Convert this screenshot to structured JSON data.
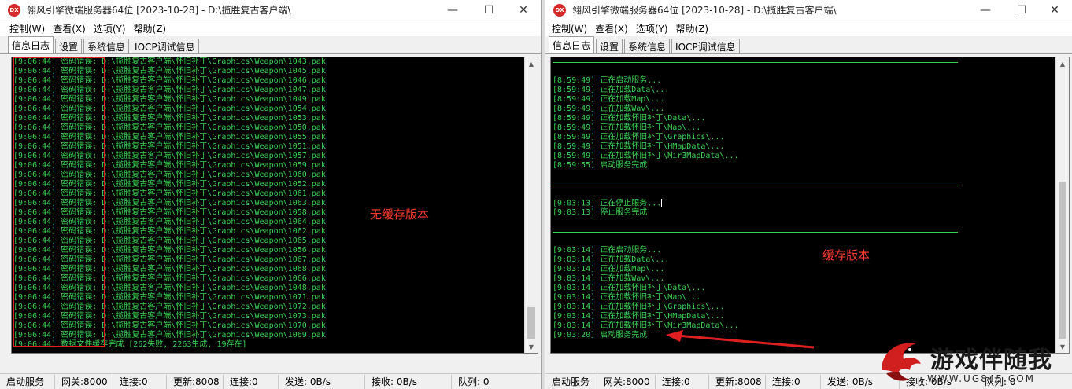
{
  "left": {
    "title": "翎风引擎微端服务器64位 [2023-10-28] - D:\\揽胜复古客户端\\",
    "menu": [
      "控制(W)",
      "查看(X)",
      "选项(Y)",
      "帮助(Z)"
    ],
    "tabs": [
      "信息日志",
      "设置",
      "系统信息",
      "IOCP调试信息"
    ],
    "log": [
      "[9:06:44] 密码错误: D:\\揽胜复古客户端\\怀旧补丁\\Graphics\\Weapon\\1043.pak",
      "[9:06:44] 密码错误: D:\\揽胜复古客户端\\怀旧补丁\\Graphics\\Weapon\\1045.pak",
      "[9:06:44] 密码错误: D:\\揽胜复古客户端\\怀旧补丁\\Graphics\\Weapon\\1046.pak",
      "[9:06:44] 密码错误: D:\\揽胜复古客户端\\怀旧补丁\\Graphics\\Weapon\\1047.pak",
      "[9:06:44] 密码错误: D:\\揽胜复古客户端\\怀旧补丁\\Graphics\\Weapon\\1049.pak",
      "[9:06:44] 密码错误: D:\\揽胜复古客户端\\怀旧补丁\\Graphics\\Weapon\\1054.pak",
      "[9:06:44] 密码错误: D:\\揽胜复古客户端\\怀旧补丁\\Graphics\\Weapon\\1053.pak",
      "[9:06:44] 密码错误: D:\\揽胜复古客户端\\怀旧补丁\\Graphics\\Weapon\\1050.pak",
      "[9:06:44] 密码错误: D:\\揽胜复古客户端\\怀旧补丁\\Graphics\\Weapon\\1055.pak",
      "[9:06:44] 密码错误: D:\\揽胜复古客户端\\怀旧补丁\\Graphics\\Weapon\\1051.pak",
      "[9:06:44] 密码错误: D:\\揽胜复古客户端\\怀旧补丁\\Graphics\\Weapon\\1057.pak",
      "[9:06:44] 密码错误: D:\\揽胜复古客户端\\怀旧补丁\\Graphics\\Weapon\\1059.pak",
      "[9:06:44] 密码错误: D:\\揽胜复古客户端\\怀旧补丁\\Graphics\\Weapon\\1060.pak",
      "[9:06:44] 密码错误: D:\\揽胜复古客户端\\怀旧补丁\\Graphics\\Weapon\\1052.pak",
      "[9:06:44] 密码错误: D:\\揽胜复古客户端\\怀旧补丁\\Graphics\\Weapon\\1061.pak",
      "[9:06:44] 密码错误: D:\\揽胜复古客户端\\怀旧补丁\\Graphics\\Weapon\\1063.pak",
      "[9:06:44] 密码错误: D:\\揽胜复古客户端\\怀旧补丁\\Graphics\\Weapon\\1058.pak",
      "[9:06:44] 密码错误: D:\\揽胜复古客户端\\怀旧补丁\\Graphics\\Weapon\\1064.pak",
      "[9:06:44] 密码错误: D:\\揽胜复古客户端\\怀旧补丁\\Graphics\\Weapon\\1062.pak",
      "[9:06:44] 密码错误: D:\\揽胜复古客户端\\怀旧补丁\\Graphics\\Weapon\\1065.pak",
      "[9:06:44] 密码错误: D:\\揽胜复古客户端\\怀旧补丁\\Graphics\\Weapon\\1056.pak",
      "[9:06:44] 密码错误: D:\\揽胜复古客户端\\怀旧补丁\\Graphics\\Weapon\\1067.pak",
      "[9:06:44] 密码错误: D:\\揽胜复古客户端\\怀旧补丁\\Graphics\\Weapon\\1068.pak",
      "[9:06:44] 密码错误: D:\\揽胜复古客户端\\怀旧补丁\\Graphics\\Weapon\\1066.pak",
      "[9:06:44] 密码错误: D:\\揽胜复古客户端\\怀旧补丁\\Graphics\\Weapon\\1048.pak",
      "[9:06:44] 密码错误: D:\\揽胜复古客户端\\怀旧补丁\\Graphics\\Weapon\\1071.pak",
      "[9:06:44] 密码错误: D:\\揽胜复古客户端\\怀旧补丁\\Graphics\\Weapon\\1072.pak",
      "[9:06:44] 密码错误: D:\\揽胜复古客户端\\怀旧补丁\\Graphics\\Weapon\\1073.pak",
      "[9:06:44] 密码错误: D:\\揽胜复古客户端\\怀旧补丁\\Graphics\\Weapon\\1070.pak",
      "[9:06:44] 密码错误: D:\\揽胜复古客户端\\怀旧补丁\\Graphics\\Weapon\\1069.pak",
      "[9:06:44] 数据文件缓存完成 [262失败, 2263生成, 19存在]"
    ],
    "annotation": "无缓存版本",
    "status": [
      "启动服务",
      "网关:8000",
      "连接:0",
      "更新:8008",
      "连接:0",
      "发送: 0B/s",
      "接收: 0B/s",
      "队列: 0"
    ]
  },
  "right": {
    "title": "翎风引擎微端服务器64位 [2023-10-28] - D:\\揽胜复古客户端\\",
    "menu": [
      "控制(W)",
      "查看(X)",
      "选项(Y)",
      "帮助(Z)"
    ],
    "tabs": [
      "信息日志",
      "设置",
      "系统信息",
      "IOCP调试信息"
    ],
    "log_block1": [
      "[8:59:49] 正在启动服务...",
      "[8:59:49] 正在加载Data\\...",
      "[8:59:49] 正在加载Map\\...",
      "[8:59:49] 正在加载Wav\\...",
      "[8:59:49] 正在加载怀旧补丁\\Data\\...",
      "[8:59:49] 正在加载怀旧补丁\\Map\\...",
      "[8:59:49] 正在加载怀旧补丁\\Graphics\\...",
      "[8:59:49] 正在加载怀旧补丁\\HMapData\\...",
      "[8:59:49] 正在加载怀旧补丁\\Mir3MapData\\...",
      "[8:59:55] 启动服务完成"
    ],
    "log_block2": [
      "[9:03:13] 正在停止服务...",
      "[9:03:13] 停止服务完成"
    ],
    "log_block3": [
      "[9:03:14] 正在启动服务...",
      "[9:03:14] 正在加载Data\\...",
      "[9:03:14] 正在加载Map\\...",
      "[9:03:14] 正在加载Wav\\...",
      "[9:03:14] 正在加载怀旧补丁\\Data\\...",
      "[9:03:14] 正在加载怀旧补丁\\Map\\...",
      "[9:03:14] 正在加载怀旧补丁\\Graphics\\...",
      "[9:03:14] 正在加载怀旧补丁\\HMapData\\...",
      "[9:03:14] 正在加载怀旧补丁\\Mir3MapData\\...",
      "[9:03:20] 启动服务完成"
    ],
    "annotation": "缓存版本",
    "status": [
      "启动服务",
      "网关:8000",
      "连接:0",
      "更新:8008",
      "连接:0",
      "发送: 0B/s",
      "接收: 0B/s",
      "队列: 0"
    ]
  },
  "watermark": {
    "text": "游戏伴随我",
    "url": "WWW.UG845.COM"
  },
  "colors": {
    "console_bg": "#000000",
    "console_text": "#39d353",
    "annotation": "#ff3b2f"
  },
  "icons": [
    "app-icon",
    "minimize-icon",
    "maximize-icon",
    "close-icon",
    "scroll-up-icon",
    "scroll-down-icon",
    "red-arrow",
    "dragon-logo"
  ]
}
